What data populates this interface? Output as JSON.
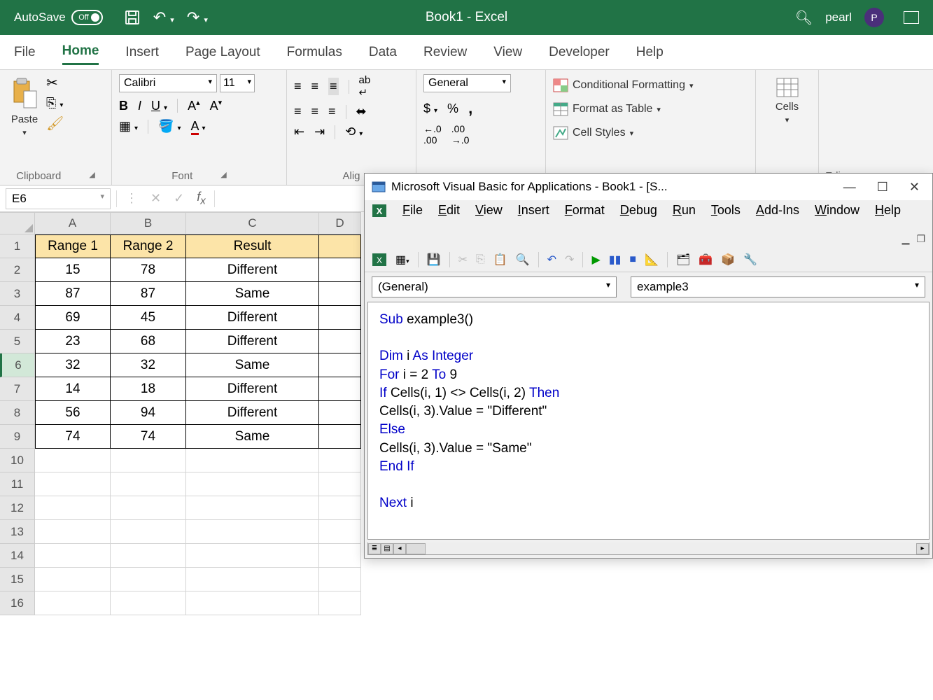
{
  "titlebar": {
    "autosave_label": "AutoSave",
    "autosave_state": "Off",
    "app_title": "Book1 - Excel",
    "user_name": "pearl",
    "user_initial": "P"
  },
  "tabs": [
    "File",
    "Home",
    "Insert",
    "Page Layout",
    "Formulas",
    "Data",
    "Review",
    "View",
    "Developer",
    "Help"
  ],
  "active_tab": "Home",
  "ribbon": {
    "clipboard": {
      "paste": "Paste",
      "label": "Clipboard"
    },
    "font": {
      "name": "Calibri",
      "size": "11",
      "label": "Font"
    },
    "alignment": {
      "label": "Alig"
    },
    "number": {
      "format": "General"
    },
    "styles": {
      "conditional": "Conditional Formatting",
      "table": "Format as Table",
      "cell": "Cell Styles"
    },
    "cells": {
      "label": "Cells"
    },
    "editing": {
      "label": "Edi"
    }
  },
  "formula_bar": {
    "name_box": "E6"
  },
  "sheet": {
    "columns": [
      "A",
      "B",
      "C",
      "D"
    ],
    "selected_row": 6,
    "headers": [
      "Range 1",
      "Range 2",
      "Result"
    ],
    "data": [
      [
        "15",
        "78",
        "Different"
      ],
      [
        "87",
        "87",
        "Same"
      ],
      [
        "69",
        "45",
        "Different"
      ],
      [
        "23",
        "68",
        "Different"
      ],
      [
        "32",
        "32",
        "Same"
      ],
      [
        "14",
        "18",
        "Different"
      ],
      [
        "56",
        "94",
        "Different"
      ],
      [
        "74",
        "74",
        "Same"
      ]
    ],
    "empty_rows": [
      10,
      11,
      12,
      13,
      14,
      15,
      16
    ]
  },
  "vba": {
    "title": "Microsoft Visual Basic for Applications - Book1 - [S...",
    "menus": [
      "File",
      "Edit",
      "View",
      "Insert",
      "Format",
      "Debug",
      "Run",
      "Tools",
      "Add-Ins",
      "Window",
      "Help"
    ],
    "dd_left": "(General)",
    "dd_right": "example3",
    "code_lines": [
      {
        "indent": 0,
        "tokens": [
          {
            "t": "Sub ",
            "c": "kw"
          },
          {
            "t": "example3()"
          }
        ]
      },
      {
        "indent": 0,
        "tokens": []
      },
      {
        "indent": 1,
        "tokens": [
          {
            "t": "Dim ",
            "c": "kw"
          },
          {
            "t": "i "
          },
          {
            "t": "As Integer",
            "c": "kw"
          }
        ]
      },
      {
        "indent": 1,
        "tokens": [
          {
            "t": "For ",
            "c": "kw"
          },
          {
            "t": "i = 2 "
          },
          {
            "t": "To ",
            "c": "kw"
          },
          {
            "t": "9"
          }
        ]
      },
      {
        "indent": 2,
        "tokens": [
          {
            "t": "If ",
            "c": "kw"
          },
          {
            "t": "Cells(i, 1) <> Cells(i, 2) "
          },
          {
            "t": "Then",
            "c": "kw"
          }
        ]
      },
      {
        "indent": 3,
        "tokens": [
          {
            "t": "Cells(i, 3).Value = \"Different\""
          }
        ]
      },
      {
        "indent": 2,
        "tokens": [
          {
            "t": "Else",
            "c": "kw"
          }
        ]
      },
      {
        "indent": 3,
        "tokens": [
          {
            "t": "Cells(i, 3).Value = \"Same\""
          }
        ]
      },
      {
        "indent": 2,
        "tokens": [
          {
            "t": "End If",
            "c": "kw"
          }
        ]
      },
      {
        "indent": 0,
        "tokens": []
      },
      {
        "indent": 1,
        "tokens": [
          {
            "t": "Next ",
            "c": "kw"
          },
          {
            "t": "i"
          }
        ]
      }
    ]
  }
}
